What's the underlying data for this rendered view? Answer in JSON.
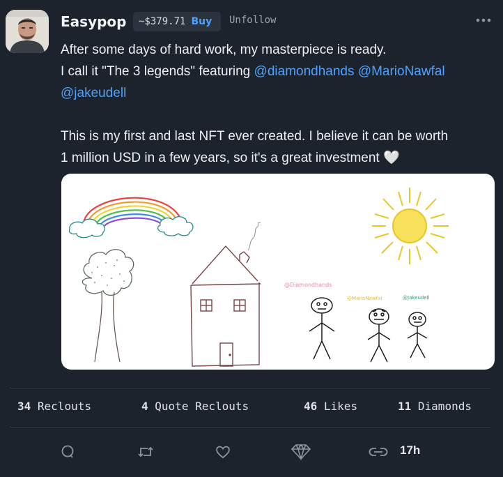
{
  "author": {
    "name": "Easypop",
    "price": "~$379.71",
    "buy_label": "Buy",
    "unfollow_label": "Unfollow"
  },
  "post": {
    "line1": "After some days of hard work, my masterpiece is ready.",
    "line2_text": "I call it \"The 3 legends\" featuring ",
    "mention1": "@diamondhands",
    "mention2": "@MarioNawfal",
    "mention3": "@jakeudell",
    "line4": "This is my first and last NFT ever created. I believe it can be worth",
    "line5": "1 million USD in a few years, so it's a great investment ",
    "heart_emoji": "🤍"
  },
  "drawing_labels": {
    "label1": "@Diamondhands",
    "label2": "@MarioNawfal",
    "label3": "@Jakeudell"
  },
  "stats": {
    "reclouts_count": "34",
    "reclouts_label": "Reclouts",
    "quote_count": "4",
    "quote_label": "Quote Reclouts",
    "likes_count": "46",
    "likes_label": "Likes",
    "diamonds_count": "11",
    "diamonds_label": "Diamonds"
  },
  "actions": {
    "time": "17h"
  },
  "colors": {
    "background": "#1c232d",
    "accent": "#4ea2ff"
  },
  "icons": [
    "more-options-icon",
    "comment-icon",
    "reclout-icon",
    "like-icon",
    "diamond-icon",
    "link-icon"
  ]
}
